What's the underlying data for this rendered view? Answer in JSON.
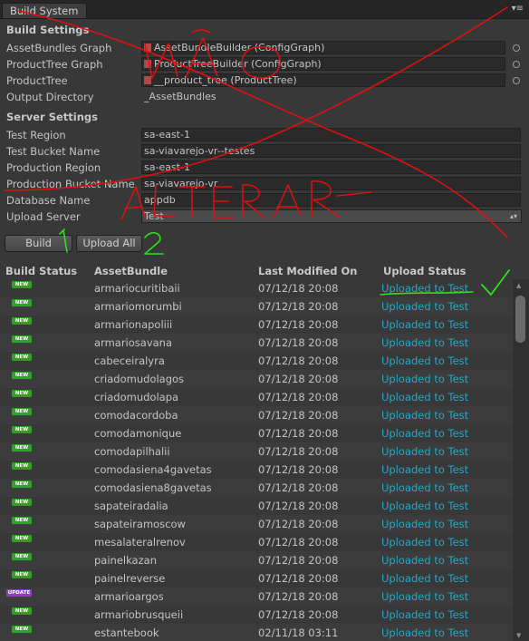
{
  "window": {
    "tab_label": "Build System",
    "menu_glyph": "▾≡"
  },
  "build_settings": {
    "title": "Build Settings",
    "rows": [
      {
        "label": "AssetBundles Graph",
        "value": "AssetBundleBuilder (ConfigGraph)"
      },
      {
        "label": "ProductTree Graph",
        "value": "ProductTreeBuilder (ConfigGraph)"
      },
      {
        "label": "ProductTree",
        "value": "__product_tree (ProductTree)"
      },
      {
        "label": "Output Directory",
        "value": "_AssetBundles"
      }
    ]
  },
  "server_settings": {
    "title": "Server Settings",
    "rows": [
      {
        "label": "Test Region",
        "value": "sa-east-1"
      },
      {
        "label": "Test Bucket Name",
        "value": "sa-viavarejo-vr--testes"
      },
      {
        "label": "Production Region",
        "value": "sa-east-1"
      },
      {
        "label": "Production Bucket Name",
        "value": "sa-viavarejo-vr"
      },
      {
        "label": "Database Name",
        "value": "appdb"
      },
      {
        "label": "Upload Server",
        "value": "Test"
      }
    ]
  },
  "actions": {
    "build_label": "Build",
    "upload_all_label": "Upload All"
  },
  "table": {
    "headers": {
      "build_status": "Build Status",
      "asset_bundle": "AssetBundle",
      "last_modified": "Last Modified On",
      "upload_status": "Upload Status"
    },
    "rows": [
      {
        "badge": "NEW",
        "name": "armariocuritibaii",
        "date": "07/12/18 20:08",
        "status": "Uploaded to Test"
      },
      {
        "badge": "NEW",
        "name": "armariomorumbi",
        "date": "07/12/18 20:08",
        "status": "Uploaded to Test"
      },
      {
        "badge": "NEW",
        "name": "armarionapoliii",
        "date": "07/12/18 20:08",
        "status": "Uploaded to Test"
      },
      {
        "badge": "NEW",
        "name": "armariosavana",
        "date": "07/12/18 20:08",
        "status": "Uploaded to Test"
      },
      {
        "badge": "NEW",
        "name": "cabeceiralyra",
        "date": "07/12/18 20:08",
        "status": "Uploaded to Test"
      },
      {
        "badge": "NEW",
        "name": "criadomudolagos",
        "date": "07/12/18 20:08",
        "status": "Uploaded to Test"
      },
      {
        "badge": "NEW",
        "name": "criadomudolapa",
        "date": "07/12/18 20:08",
        "status": "Uploaded to Test"
      },
      {
        "badge": "NEW",
        "name": "comodacordoba",
        "date": "07/12/18 20:08",
        "status": "Uploaded to Test"
      },
      {
        "badge": "NEW",
        "name": "comodamonique",
        "date": "07/12/18 20:08",
        "status": "Uploaded to Test"
      },
      {
        "badge": "NEW",
        "name": "comodapilhalii",
        "date": "07/12/18 20:08",
        "status": "Uploaded to Test"
      },
      {
        "badge": "NEW",
        "name": "comodasiena4gavetas",
        "date": "07/12/18 20:08",
        "status": "Uploaded to Test"
      },
      {
        "badge": "NEW",
        "name": "comodasiena8gavetas",
        "date": "07/12/18 20:08",
        "status": "Uploaded to Test"
      },
      {
        "badge": "NEW",
        "name": "sapateiradalia",
        "date": "07/12/18 20:08",
        "status": "Uploaded to Test"
      },
      {
        "badge": "NEW",
        "name": "sapateiramoscow",
        "date": "07/12/18 20:08",
        "status": "Uploaded to Test"
      },
      {
        "badge": "NEW",
        "name": "mesalateralrenov",
        "date": "07/12/18 20:08",
        "status": "Uploaded to Test"
      },
      {
        "badge": "NEW",
        "name": "painelkazan",
        "date": "07/12/18 20:08",
        "status": "Uploaded to Test"
      },
      {
        "badge": "NEW",
        "name": "painelreverse",
        "date": "07/12/18 20:08",
        "status": "Uploaded to Test"
      },
      {
        "badge": "UPDATE",
        "name": "armarioargos",
        "date": "07/12/18 20:08",
        "status": "Uploaded to Test"
      },
      {
        "badge": "NEW",
        "name": "armariobrusqueii",
        "date": "07/12/18 20:08",
        "status": "Uploaded to Test"
      },
      {
        "badge": "NEW",
        "name": "estantebook",
        "date": "02/11/18 03:11",
        "status": "Uploaded to Test"
      }
    ]
  },
  "annotations": {
    "scrawl_words": [
      "NÃO",
      "ALTERAR"
    ],
    "step_numbers": [
      "1",
      "2"
    ],
    "ink_colors": {
      "red": "#e01010",
      "green": "#2ee01e"
    }
  }
}
